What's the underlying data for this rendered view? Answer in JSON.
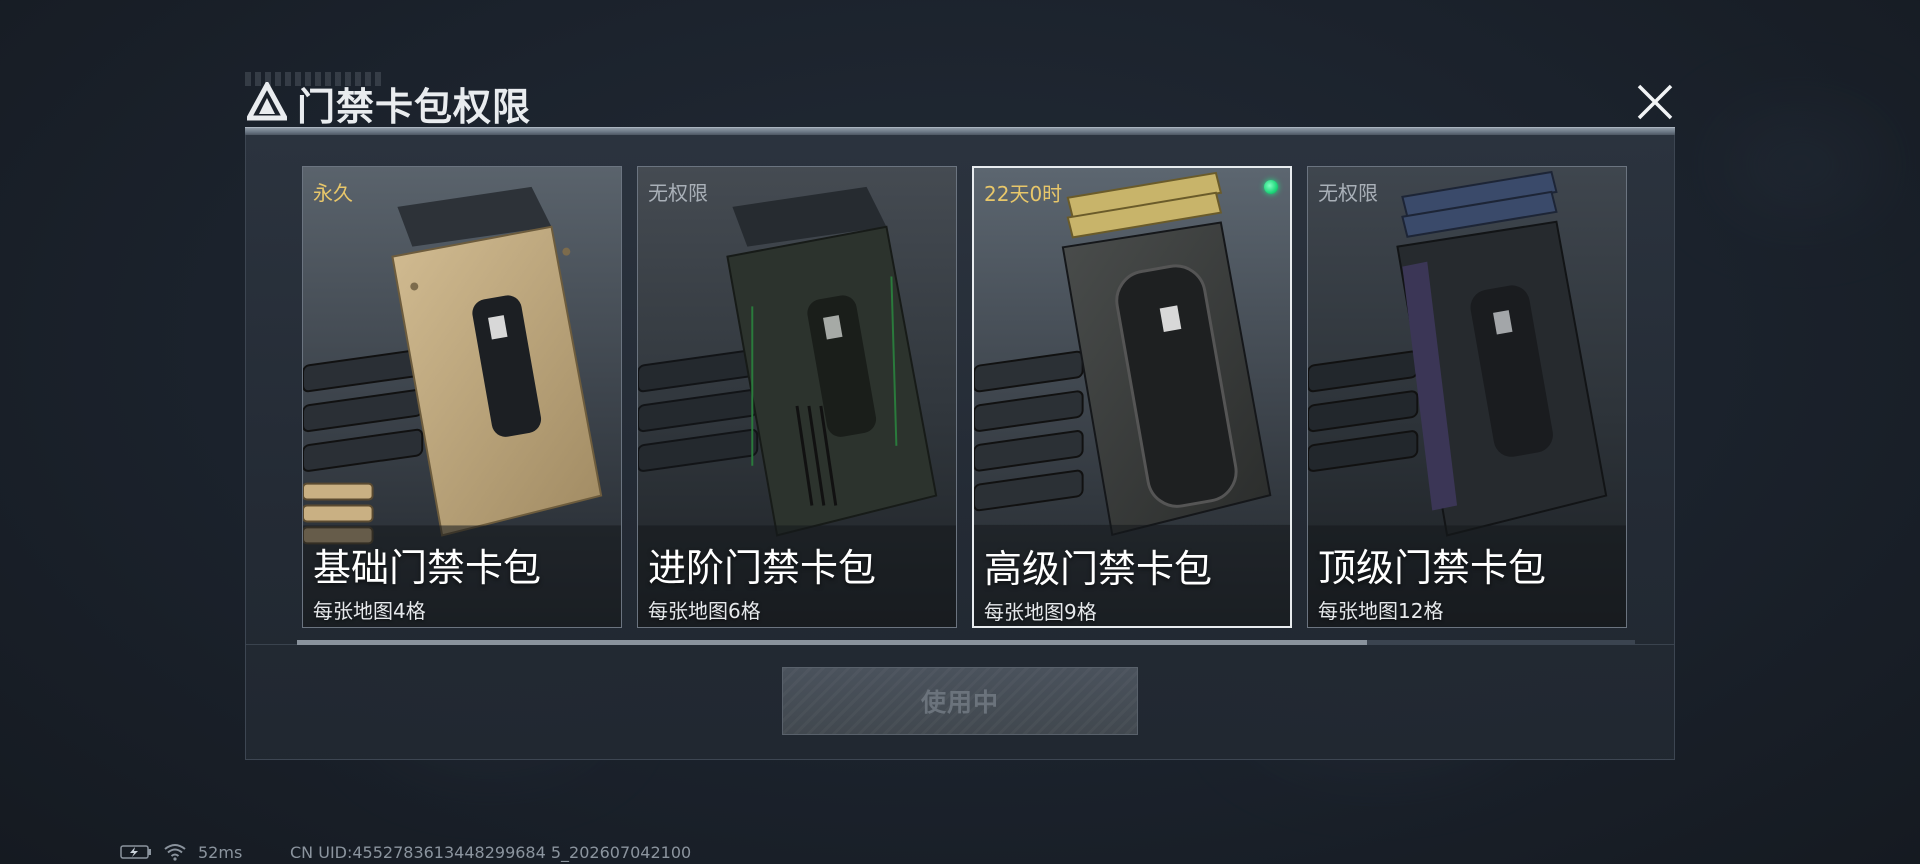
{
  "dialog": {
    "title": "门禁卡包权限",
    "icon": "triangle-logo-icon",
    "close_icon": "close-icon"
  },
  "cards": [
    {
      "status": "永久",
      "status_color": "#e8c76a",
      "name": "基础门禁卡包",
      "subtitle": "每张地图4格",
      "theme": "tan",
      "selected": false,
      "active": false
    },
    {
      "status": "无权限",
      "status_color": "#a9b0b8",
      "name": "进阶门禁卡包",
      "subtitle": "每张地图6格",
      "theme": "green",
      "selected": false,
      "active": false
    },
    {
      "status": "22天0时",
      "status_color": "#e8c76a",
      "name": "高级门禁卡包",
      "subtitle": "每张地图9格",
      "theme": "gold",
      "selected": true,
      "active": true
    },
    {
      "status": "无权限",
      "status_color": "#a9b0b8",
      "name": "顶级门禁卡包",
      "subtitle": "每张地图12格",
      "theme": "blue",
      "selected": false,
      "active": false
    }
  ],
  "action_button": {
    "label": "使用中",
    "disabled": true
  },
  "scroll": {
    "fraction": 0.8
  },
  "statusbar": {
    "ping": "52ms",
    "uid": "CN UID:4552783613448299684 5_202607042100",
    "battery_icon": "battery-charging-icon",
    "wifi_icon": "wifi-icon"
  },
  "colors": {
    "accent_active": "#1fd67a",
    "status_gold": "#e8c76a",
    "status_grey": "#a9b0b8"
  }
}
